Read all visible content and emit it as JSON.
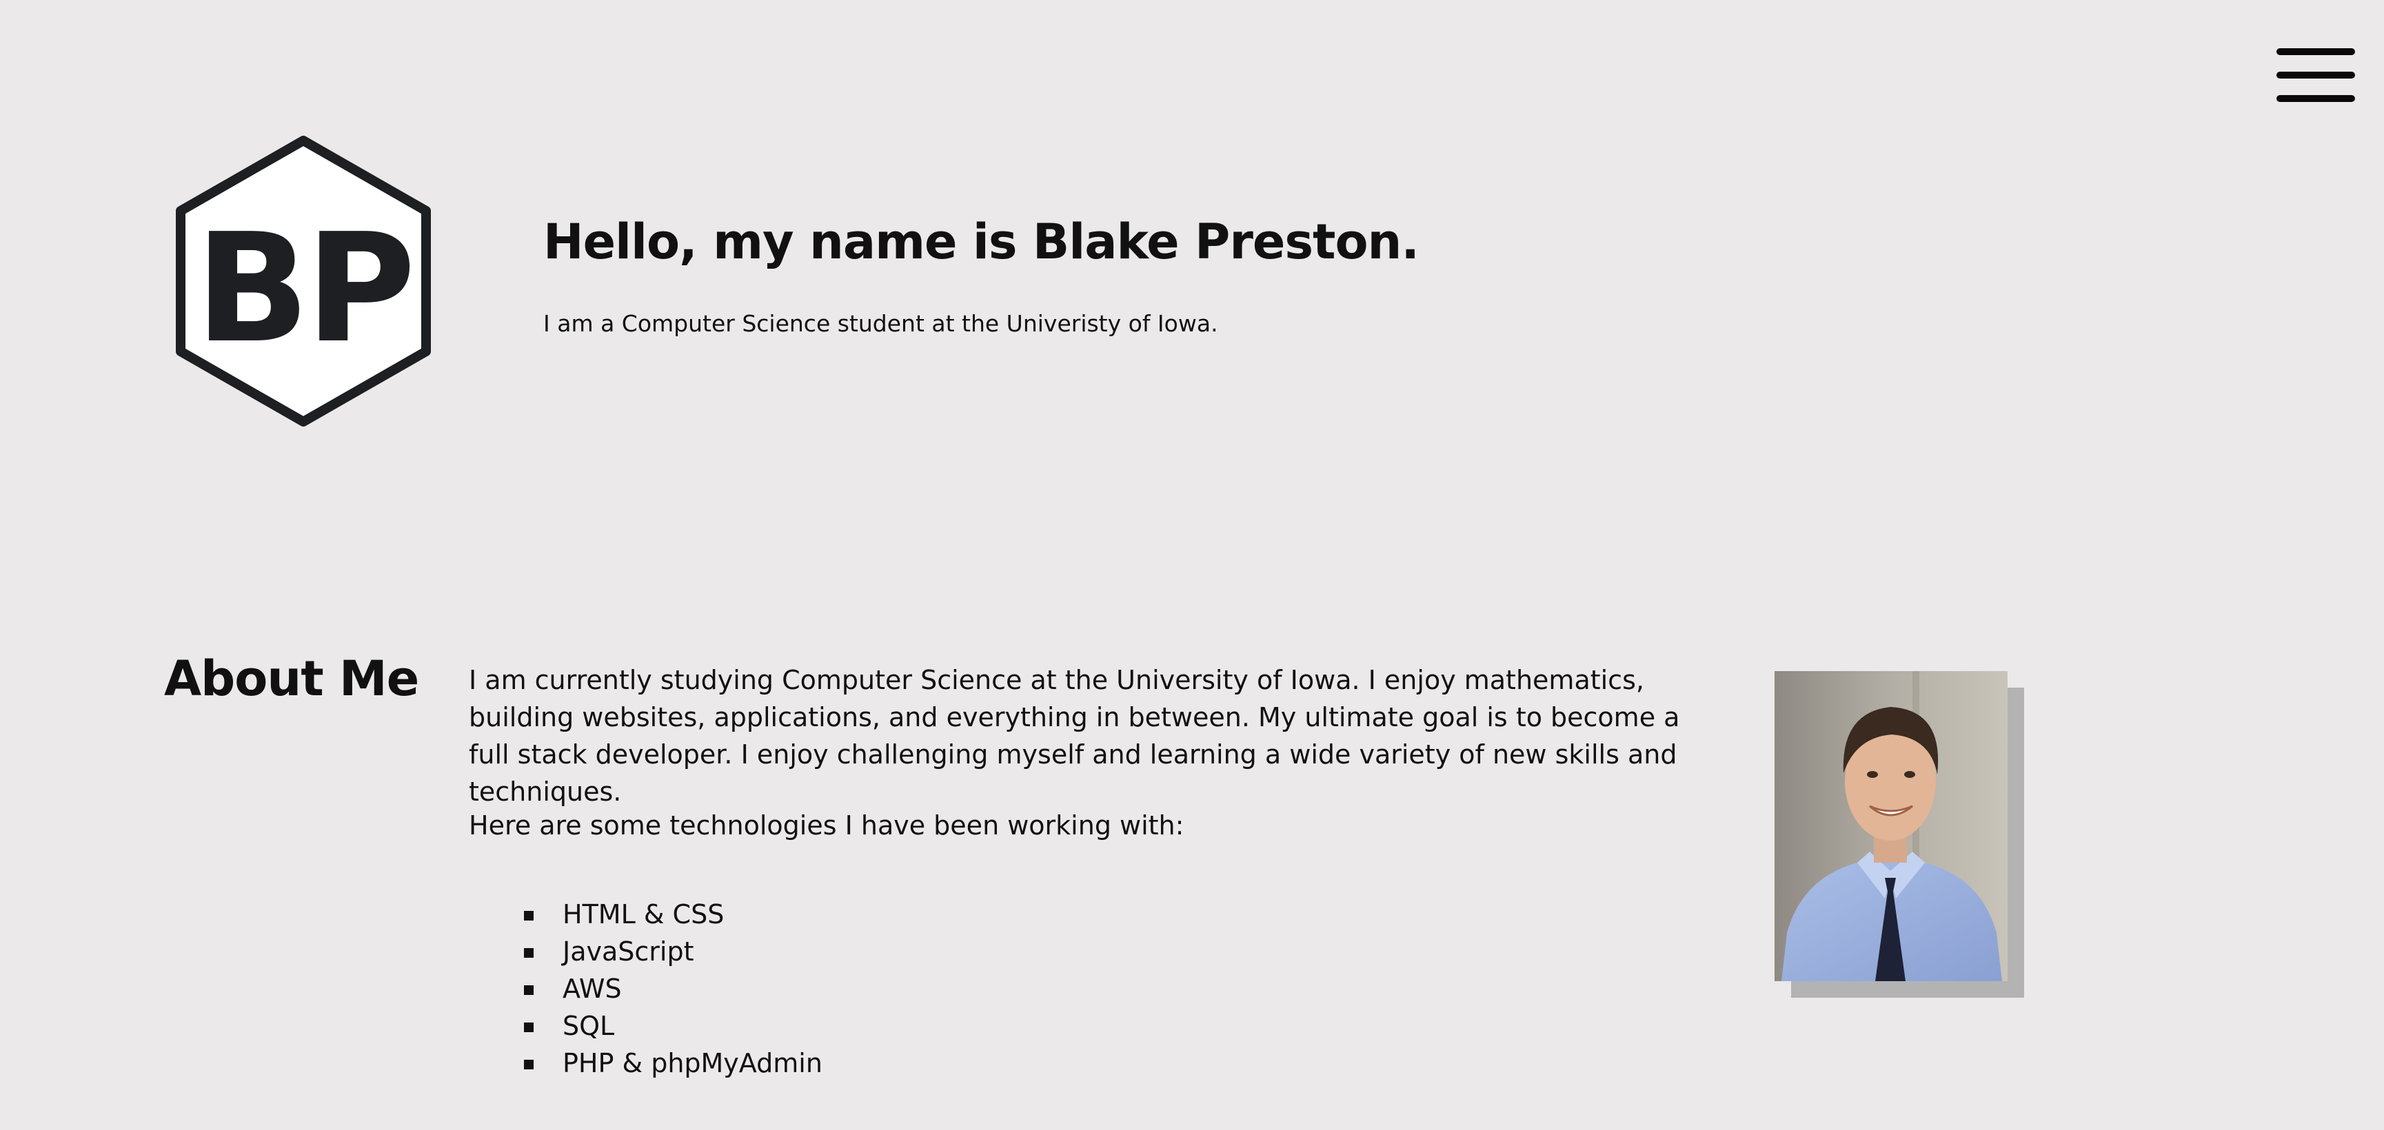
{
  "header": {
    "menu_icon": "hamburger-menu-icon"
  },
  "logo": {
    "text": "BP"
  },
  "hero": {
    "title": "Hello, my name is Blake Preston.",
    "subtitle": "I am a Computer Science student at the Univeristy of Iowa."
  },
  "about": {
    "heading": "About Me",
    "body": "I am currently studying Computer Science at the University of Iowa. I enjoy mathematics, building websites, applications, and everything in between. My ultimate goal is to become a full stack developer. I enjoy challenging myself and learning a wide variety of new skills and techniques.",
    "tech_intro": "Here are some technologies I have been working with:",
    "technologies": [
      "HTML & CSS",
      "JavaScript",
      "AWS",
      "SQL",
      "PHP & phpMyAdmin"
    ],
    "photo_icon": "profile-photo"
  },
  "colors": {
    "background": "#ebe9e9",
    "text": "#111111",
    "logo_stroke": "#1e1f22",
    "photo_shadow": "#b3b3b3"
  }
}
